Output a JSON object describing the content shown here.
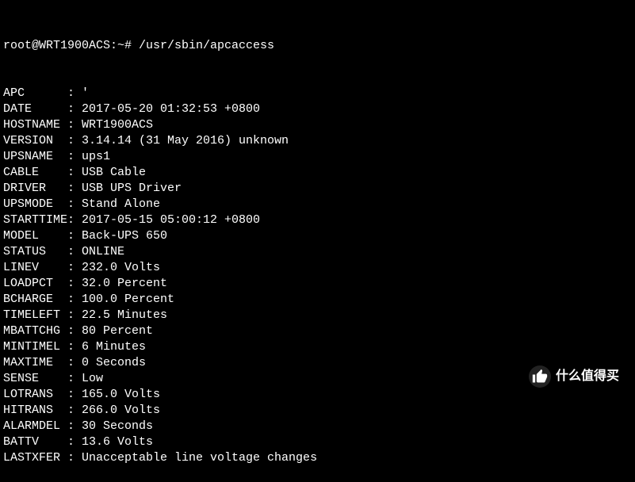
{
  "prompt": "root@WRT1900ACS:~# /usr/sbin/apcaccess",
  "fields": [
    {
      "label": "APC",
      "value": "'"
    },
    {
      "label": "DATE",
      "value": "2017-05-20 01:32:53 +0800"
    },
    {
      "label": "HOSTNAME",
      "value": "WRT1900ACS"
    },
    {
      "label": "VERSION",
      "value": "3.14.14 (31 May 2016) unknown"
    },
    {
      "label": "UPSNAME",
      "value": "ups1"
    },
    {
      "label": "CABLE",
      "value": "USB Cable"
    },
    {
      "label": "DRIVER",
      "value": "USB UPS Driver"
    },
    {
      "label": "UPSMODE",
      "value": "Stand Alone"
    },
    {
      "label": "STARTTIME",
      "value": "2017-05-15 05:00:12 +0800"
    },
    {
      "label": "MODEL",
      "value": "Back-UPS 650"
    },
    {
      "label": "STATUS",
      "value": "ONLINE"
    },
    {
      "label": "LINEV",
      "value": "232.0 Volts"
    },
    {
      "label": "LOADPCT",
      "value": "32.0 Percent"
    },
    {
      "label": "BCHARGE",
      "value": "100.0 Percent"
    },
    {
      "label": "TIMELEFT",
      "value": "22.5 Minutes"
    },
    {
      "label": "MBATTCHG",
      "value": "80 Percent"
    },
    {
      "label": "MINTIMEL",
      "value": "6 Minutes"
    },
    {
      "label": "MAXTIME",
      "value": "0 Seconds"
    },
    {
      "label": "SENSE",
      "value": "Low"
    },
    {
      "label": "LOTRANS",
      "value": "165.0 Volts"
    },
    {
      "label": "HITRANS",
      "value": "266.0 Volts"
    },
    {
      "label": "ALARMDEL",
      "value": "30 Seconds"
    },
    {
      "label": "BATTV",
      "value": "13.6 Volts"
    },
    {
      "label": "LASTXFER",
      "value": "Unacceptable line voltage changes"
    }
  ],
  "watermark": "什么值得买"
}
